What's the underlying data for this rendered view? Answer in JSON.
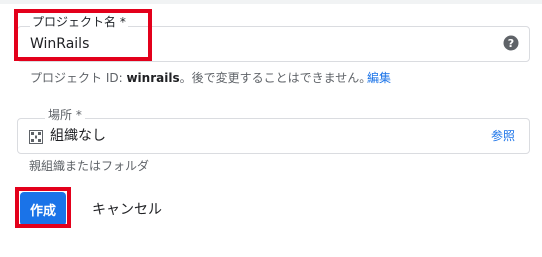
{
  "project_name": {
    "label": "プロジェクト名 *",
    "value": "WinRails"
  },
  "project_id": {
    "prefix": "プロジェクト ID: ",
    "id": "winrails",
    "suffix": "。後で変更することはできません。",
    "edit_label": "編集"
  },
  "location": {
    "label": "場所 *",
    "value": "組織なし",
    "browse_label": "参照",
    "hint": "親組織またはフォルダ"
  },
  "actions": {
    "create_label": "作成",
    "cancel_label": "キャンセル"
  },
  "colors": {
    "accent": "#1a73e8",
    "highlight": "#e3001b",
    "border": "#dadce0"
  },
  "icons": [
    "help-icon",
    "organization-icon"
  ]
}
